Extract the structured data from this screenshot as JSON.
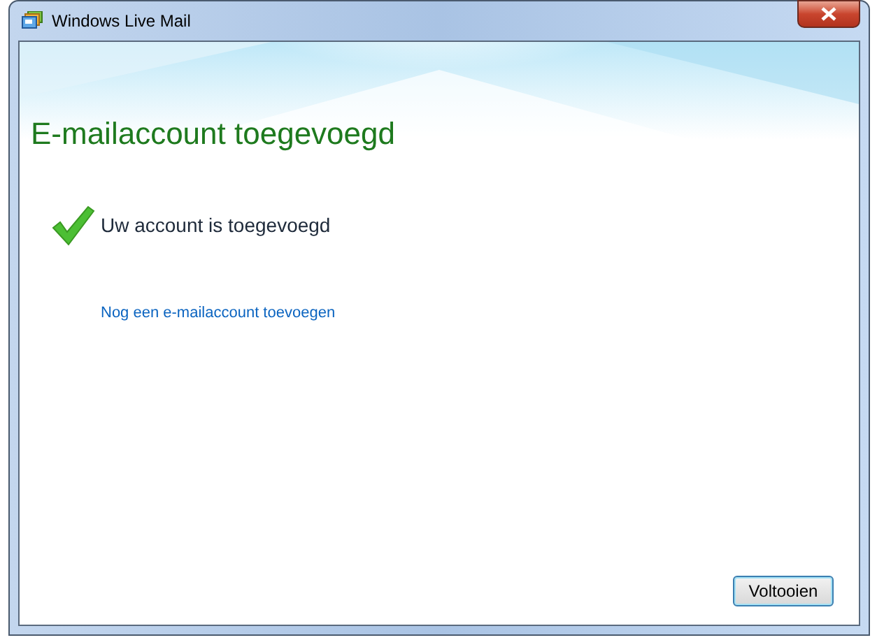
{
  "window": {
    "title": "Windows Live Mail"
  },
  "heading": "E-mailaccount toegevoegd",
  "status": {
    "text": "Uw account is toegevoegd"
  },
  "link": "Nog een e-mailaccount toevoegen",
  "buttons": [
    "Voltooien"
  ]
}
